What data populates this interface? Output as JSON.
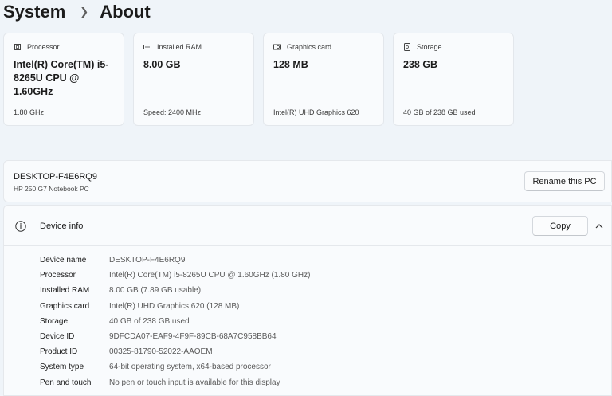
{
  "breadcrumb": {
    "parent": "System",
    "current": "About"
  },
  "cards": [
    {
      "icon": "processor-icon",
      "label": "Processor",
      "value": "Intel(R) Core(TM) i5-8265U CPU @ 1.60GHz",
      "sub": "1.80 GHz"
    },
    {
      "icon": "ram-icon",
      "label": "Installed RAM",
      "value": "8.00 GB",
      "sub": "Speed: 2400 MHz"
    },
    {
      "icon": "graphics-card-icon",
      "label": "Graphics card",
      "value": "128 MB",
      "sub": "Intel(R) UHD Graphics 620"
    },
    {
      "icon": "storage-icon",
      "label": "Storage",
      "value": "238 GB",
      "sub": "40 GB of 238 GB used"
    }
  ],
  "pc": {
    "name": "DESKTOP-F4E6RQ9",
    "model": "HP 250 G7 Notebook PC",
    "rename_label": "Rename this PC"
  },
  "device_info": {
    "title": "Device info",
    "copy_label": "Copy",
    "rows": [
      {
        "label": "Device name",
        "value": "DESKTOP-F4E6RQ9"
      },
      {
        "label": "Processor",
        "value": "Intel(R) Core(TM) i5-8265U CPU @ 1.60GHz (1.80 GHz)"
      },
      {
        "label": "Installed RAM",
        "value": "8.00 GB (7.89 GB usable)"
      },
      {
        "label": "Graphics card",
        "value": "Intel(R) UHD Graphics 620 (128 MB)"
      },
      {
        "label": "Storage",
        "value": "40 GB of 238 GB used"
      },
      {
        "label": "Device ID",
        "value": "9DFCDA07-EAF9-4F9F-89CB-68A7C958BB64"
      },
      {
        "label": "Product ID",
        "value": "00325-81790-52022-AAOEM"
      },
      {
        "label": "System type",
        "value": "64-bit operating system, x64-based processor"
      },
      {
        "label": "Pen and touch",
        "value": "No pen or touch input is available for this display"
      }
    ]
  }
}
